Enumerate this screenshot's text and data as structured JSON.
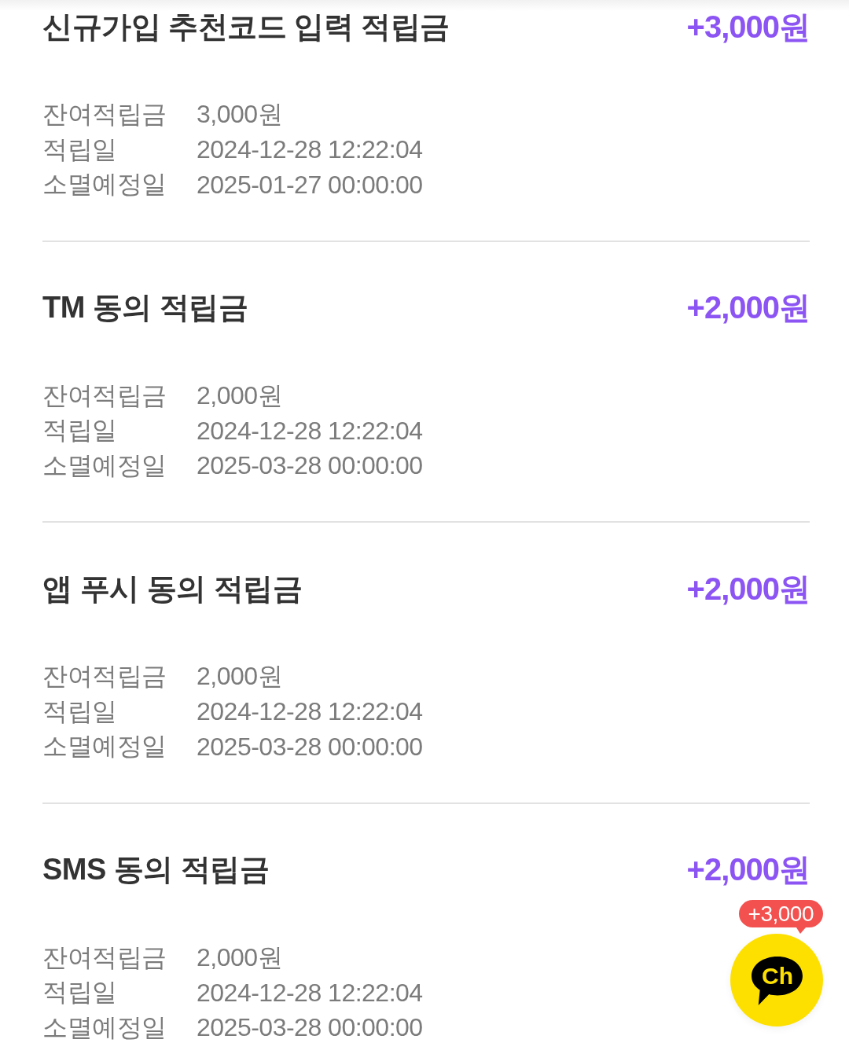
{
  "entries": [
    {
      "title": "신규가입 추천코드 입력 적립금",
      "amount": "+3,000원",
      "details": [
        {
          "label": "잔여적립금",
          "value": "3,000원"
        },
        {
          "label": "적립일",
          "value": "2024-12-28 12:22:04"
        },
        {
          "label": "소멸예정일",
          "value": "2025-01-27 00:00:00"
        }
      ]
    },
    {
      "title": "TM 동의 적립금",
      "amount": "+2,000원",
      "details": [
        {
          "label": "잔여적립금",
          "value": "2,000원"
        },
        {
          "label": "적립일",
          "value": "2024-12-28 12:22:04"
        },
        {
          "label": "소멸예정일",
          "value": "2025-03-28 00:00:00"
        }
      ]
    },
    {
      "title": "앱 푸시 동의 적립금",
      "amount": "+2,000원",
      "details": [
        {
          "label": "잔여적립금",
          "value": "2,000원"
        },
        {
          "label": "적립일",
          "value": "2024-12-28 12:22:04"
        },
        {
          "label": "소멸예정일",
          "value": "2025-03-28 00:00:00"
        }
      ]
    },
    {
      "title": "SMS 동의 적립금",
      "amount": "+2,000원",
      "details": [
        {
          "label": "잔여적립금",
          "value": "2,000원"
        },
        {
          "label": "적립일",
          "value": "2024-12-28 12:22:04"
        },
        {
          "label": "소멸예정일",
          "value": "2025-03-28 00:00:00"
        }
      ]
    }
  ],
  "channel_button": {
    "badge": "+3,000",
    "logo_text": "Ch"
  }
}
